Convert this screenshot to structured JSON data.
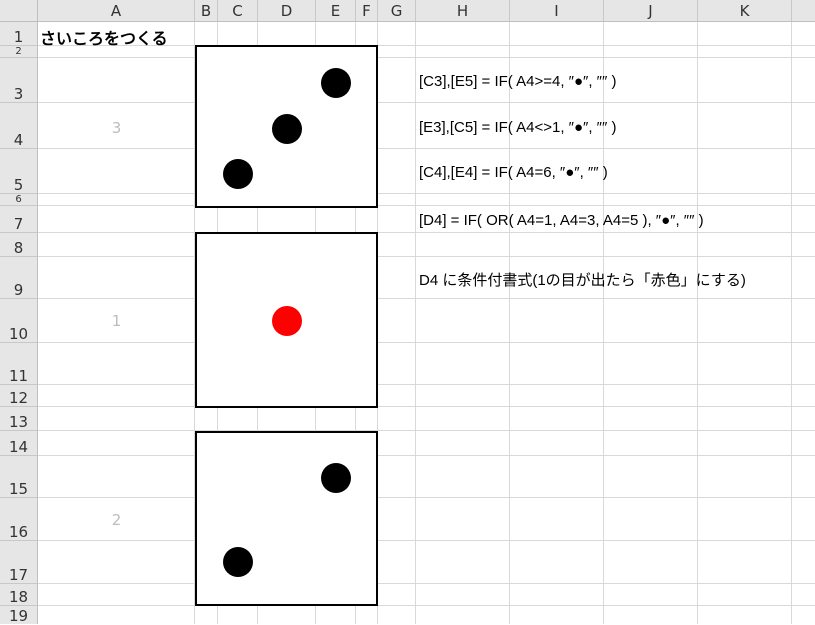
{
  "columns": [
    "A",
    "B",
    "C",
    "D",
    "E",
    "F",
    "G",
    "H",
    "I",
    "J",
    "K"
  ],
  "rows": [
    "1",
    "2",
    "3",
    "4",
    "5",
    "6",
    "7",
    "8",
    "9",
    "10",
    "11",
    "12",
    "13",
    "14",
    "15",
    "16",
    "17",
    "18",
    "19"
  ],
  "title": "さいころをつくる",
  "dice": [
    {
      "value_label": "3",
      "pips": [
        {
          "cell": "E3"
        },
        {
          "cell": "D4"
        },
        {
          "cell": "C5"
        }
      ]
    },
    {
      "value_label": "1",
      "pips": [
        {
          "cell": "D4",
          "color": "#ff0000"
        }
      ]
    },
    {
      "value_label": "2",
      "pips": [
        {
          "cell": "E3"
        },
        {
          "cell": "C5"
        }
      ]
    }
  ],
  "formulas": [
    "[C3],[E5] = IF( A4>=4, ″●″, ″″ )",
    "[E3],[C5] = IF( A4<>1, ″●″, ″″ )",
    "[C4],[E4] = IF( A4=6, ″●″, ″″ )",
    "[D4] = IF( OR( A4=1, A4=3, A4=5 ), ″●″, ″″ )",
    "D4 に条件付書式(1の目が出たら「赤色」にする)"
  ],
  "colors": {
    "pip": "#000000",
    "pip_red": "#ff0000",
    "header_bg": "#e6e6e6",
    "grid": "#d9d9d9",
    "dice_value": "#bdbdbd"
  }
}
